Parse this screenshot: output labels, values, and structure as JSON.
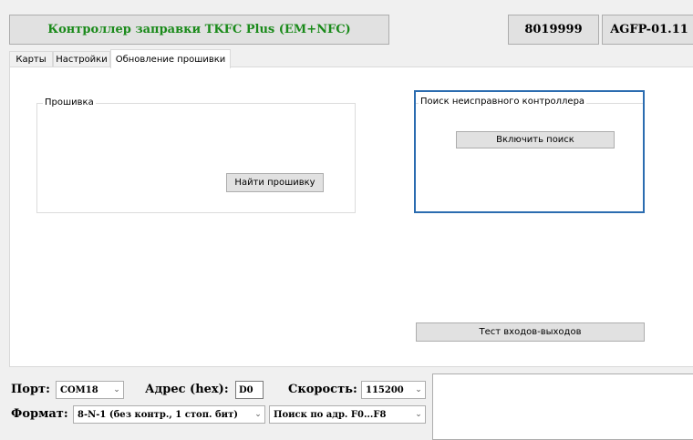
{
  "header": {
    "title_button": "Контроллер заправки TKFC Plus (EM+NFC)",
    "title_color": "#1a8a1a",
    "serial_button": "8019999",
    "version_button": "AGFP-01.11"
  },
  "tabs": [
    {
      "label": "Карты",
      "active": false
    },
    {
      "label": "Настройки",
      "active": false
    },
    {
      "label": "Обновление прошивки",
      "active": true
    }
  ],
  "firmware_group": {
    "title": "Прошивка",
    "find_button": "Найти прошивку"
  },
  "search_group": {
    "title": "Поиск неисправного контроллера",
    "enable_button": "Включить поиск",
    "border_color": "#2b6cb0"
  },
  "io_test_button": "Тест входов-выходов",
  "bottom": {
    "port_label": "Порт:",
    "port_value": "COM18",
    "address_label": "Адрес (hex):",
    "address_value": "D0",
    "speed_label": "Скорость:",
    "speed_value": "115200",
    "format_label": "Формат:",
    "format_value": "8-N-1 (без контр., 1 стоп. бит)",
    "search_addr_value": "Поиск по адр. F0...F8"
  }
}
